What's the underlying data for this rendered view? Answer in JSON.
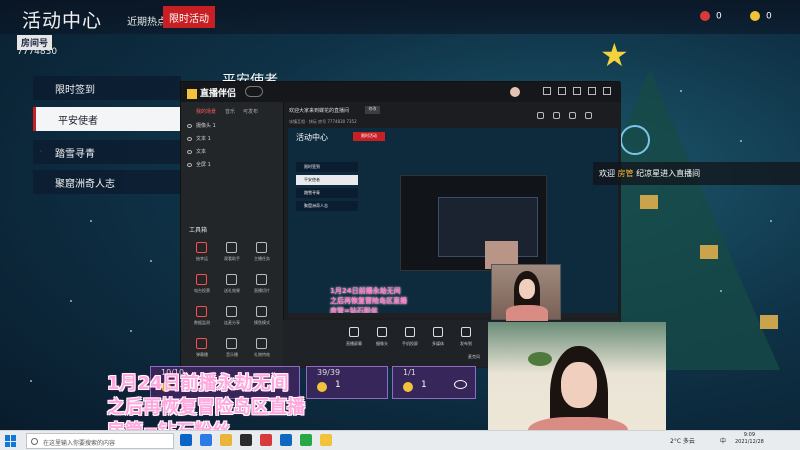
{
  "app_title": "活动中心",
  "nav_tabs": [
    "近期热点",
    "限时活动"
  ],
  "room": {
    "label": "房间号",
    "number": "7774830"
  },
  "stats": [
    {
      "icon": "rose-icon",
      "value": "0"
    },
    {
      "icon": "bean-icon",
      "value": "0"
    }
  ],
  "menu": [
    "限时签到",
    "平安使者",
    "踏雪寻青",
    "聚窟洲奇人志"
  ],
  "bg_heading": "平安使者",
  "software": {
    "name": "直播伴侣",
    "tabs": [
      "我的场景",
      "音乐",
      "可发布"
    ],
    "scenes": [
      "摄像头 1",
      "文本 1",
      "文本",
      "全屏 1"
    ],
    "tools_title": "工具箱",
    "tools": [
      "抽幸运",
      "观看助手",
      "主播任务",
      "电台投票",
      "送礼效果",
      "直播切片",
      "数据监测",
      "连麦分享",
      "摸鱼模式",
      "弹幕播",
      "音乐播",
      "礼物特效"
    ],
    "stream_title": "欢迎大家来到蝶花的直播间",
    "stream_tag": "修改",
    "stream_info": "冰镇互相 · 快玩   房号 7774830   7352",
    "bottom_buttons": [
      "直播屏幕",
      "摄像头",
      "手机投屏",
      "多媒体",
      "发布到",
      "麦克风"
    ],
    "status": "0 | 直播降噪中 已使用清晰模",
    "version": "抖音直播伴侣 5.0.0"
  },
  "preview": {
    "title": "活动中心",
    "nav": "限时活动",
    "menu": [
      "限时签到",
      "平安使者",
      "踏雪寻青",
      "聚窟洲奇人志"
    ],
    "caption": [
      "1月24日前播永劫无间",
      "之后再恢复冒险岛区直播",
      "房管=钻石粉丝"
    ]
  },
  "toast": {
    "prefix": "欢迎 ",
    "highlight": "房管",
    "suffix": " 纪凉星进入直播间"
  },
  "caption": [
    "1月24日前播永劫无间",
    "之后再恢复冒险岛区直播",
    "房管=钻石粉丝"
  ],
  "cards": [
    {
      "progress": "10/10",
      "qty": "1"
    },
    {
      "progress": "39/39",
      "qty": "1"
    },
    {
      "progress": "1/1",
      "qty": "1"
    }
  ],
  "taskbar": {
    "search_placeholder": "在这里输入你要搜索的内容",
    "temp": "2°C 多云",
    "lang": "中",
    "time": "9:09",
    "date": "2021/12/28"
  },
  "colors": {
    "accent": "#c81f24",
    "caption_pink": "#ffa7de",
    "highlight": "#ffb23c"
  }
}
